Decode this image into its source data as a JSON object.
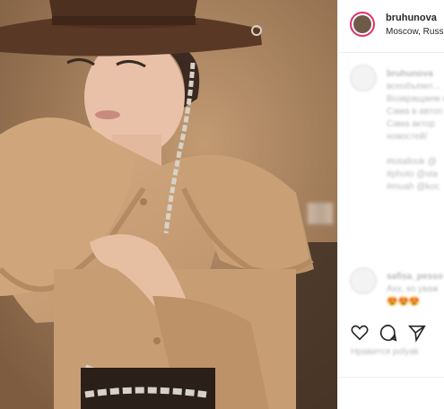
{
  "post": {
    "username": "bruhunova",
    "location": "Moscow, Russia"
  },
  "caption": {
    "username": "bruhunova",
    "lines": [
      "всеобъемл...",
      "Возвращаем с",
      "Сама в автоп",
      "Сама актор",
      "новостей/"
    ],
    "hashtags": [
      "#totallook @",
      "#photo @sta",
      "#muah @koc"
    ]
  },
  "comment": {
    "username": "safisa_pesso",
    "text": "Ахх, ко уваж",
    "emoji": "😍😍😍"
  },
  "likes_text": "Нравится polyak",
  "icons": [
    "heart-icon",
    "comment-icon",
    "share-icon"
  ]
}
